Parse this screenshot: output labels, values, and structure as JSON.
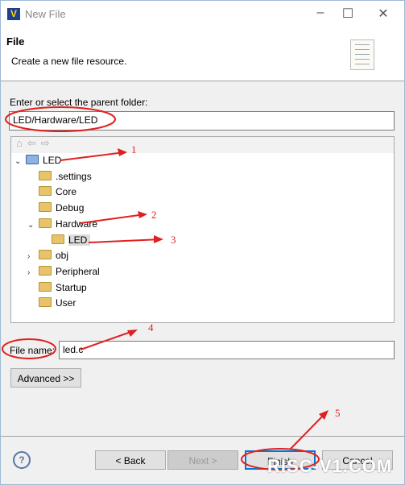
{
  "window": {
    "title": "New File",
    "minimize": "–",
    "maximize": "☐",
    "close": "✕"
  },
  "banner": {
    "title": "File",
    "description": "Create a new file resource."
  },
  "parent_folder": {
    "label": "Enter or select the parent folder:",
    "value": "LED/Hardware/LED"
  },
  "tree": {
    "toolbar": [
      "home-icon",
      "back-icon",
      "forward-icon"
    ],
    "items": [
      {
        "label": "LED",
        "level": 0,
        "expanded": true,
        "project": true
      },
      {
        "label": ".settings",
        "level": 1
      },
      {
        "label": "Core",
        "level": 1
      },
      {
        "label": "Debug",
        "level": 1
      },
      {
        "label": "Hardware",
        "level": 1,
        "expanded": true
      },
      {
        "label": "LED",
        "level": 2,
        "selected": true
      },
      {
        "label": "obj",
        "level": 1,
        "collapsed": true
      },
      {
        "label": "Peripheral",
        "level": 1,
        "collapsed": true
      },
      {
        "label": "Startup",
        "level": 1
      },
      {
        "label": "User",
        "level": 1
      }
    ]
  },
  "file_name": {
    "label": "File name:",
    "value": "led.c"
  },
  "buttons": {
    "advanced": "Advanced >>",
    "back": "< Back",
    "next": "Next >",
    "finish": "Finish",
    "cancel": "Cancel",
    "help": "?"
  },
  "annotations": {
    "numbers": [
      "1",
      "2",
      "3",
      "4",
      "5"
    ],
    "color": "#e02020"
  },
  "watermark": "RISC-V1.COM"
}
